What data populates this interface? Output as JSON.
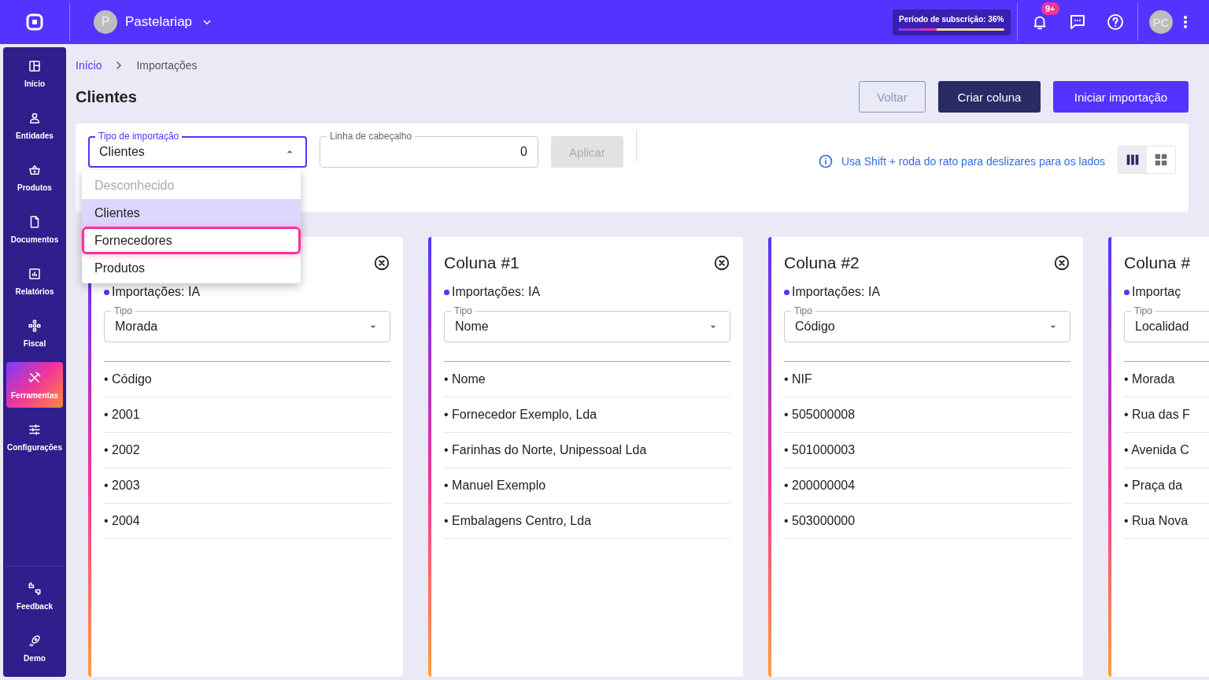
{
  "topbar": {
    "company_initial": "P",
    "company": "Pastelariap",
    "subscription": {
      "label": "Período de subscrição: 36%",
      "level": 0.36
    },
    "notifications_badge": "9+",
    "user_initials": "PC"
  },
  "sidebar": {
    "items": [
      {
        "label": "Início",
        "selected": false
      },
      {
        "label": "Entidades",
        "selected": false
      },
      {
        "label": "Produtos",
        "selected": false
      },
      {
        "label": "Documentos",
        "selected": false
      },
      {
        "label": "Relatórios",
        "selected": false
      },
      {
        "label": "Fiscal",
        "selected": false
      },
      {
        "label": "Ferramentas",
        "selected": true
      },
      {
        "label": "Configurações",
        "selected": false
      }
    ],
    "bottom_items": [
      {
        "label": "Feedback",
        "selected": false
      },
      {
        "label": "Demo",
        "selected": false
      }
    ]
  },
  "breadcrumb": [
    "Início",
    "Importações"
  ],
  "title": "Clientes",
  "actions": [
    {
      "label": "Voltar",
      "kind": "outline"
    },
    {
      "label": "Criar coluna",
      "kind": "dark"
    },
    {
      "label": "Iniciar importação",
      "kind": "primary"
    }
  ],
  "filters": {
    "import_type": {
      "label": "Tipo de importação",
      "value": "Clientes",
      "expanded": true,
      "options": [
        {
          "label": "Desconhecido",
          "disabled": true,
          "selected": false,
          "highlighted": false
        },
        {
          "label": "Clientes",
          "disabled": false,
          "selected": true,
          "highlighted": false
        },
        {
          "label": "Fornecedores",
          "disabled": false,
          "selected": false,
          "highlighted": true
        },
        {
          "label": "Produtos",
          "disabled": false,
          "selected": false,
          "highlighted": false
        }
      ]
    },
    "header_row": {
      "label": "Linha de cabeçalho",
      "value": "0"
    },
    "apply": {
      "label": "Aplicar",
      "disabled": true
    },
    "hint": "Usa Shift + roda do rato para deslizares para os lados",
    "views": [
      {
        "kind": "columns",
        "selected": true
      },
      {
        "kind": "grid",
        "selected": false
      }
    ]
  },
  "columns": [
    {
      "tag": "Importações: IA",
      "type_label": "Tipo",
      "type": "Morada",
      "closable": true,
      "rows": [
        "• Código",
        "• 2001",
        "• 2002",
        "• 2003",
        "• 2004"
      ]
    },
    {
      "title": "Coluna #1",
      "tag": "Importações: IA",
      "type_label": "Tipo",
      "type": "Nome",
      "closable": true,
      "rows": [
        "• Nome",
        "• Fornecedor Exemplo, Lda",
        "• Farinhas do Norte, Unipessoal Lda",
        "• Manuel Exemplo",
        "• Embalagens Centro, Lda"
      ]
    },
    {
      "title": "Coluna #2",
      "tag": "Importações: IA",
      "type_label": "Tipo",
      "type": "Código",
      "closable": true,
      "rows": [
        "• NIF",
        "• 505000008",
        "• 501000003",
        "• 200000004",
        "• 503000000"
      ]
    },
    {
      "title": "Coluna #",
      "tag": "Importaç",
      "type_label": "Tipo",
      "type": "Localidad",
      "closable": false,
      "rows": [
        "• Morada",
        "• Rua das F",
        "• Avenida C",
        "• Praça da",
        "• Rua Nova"
      ]
    }
  ]
}
